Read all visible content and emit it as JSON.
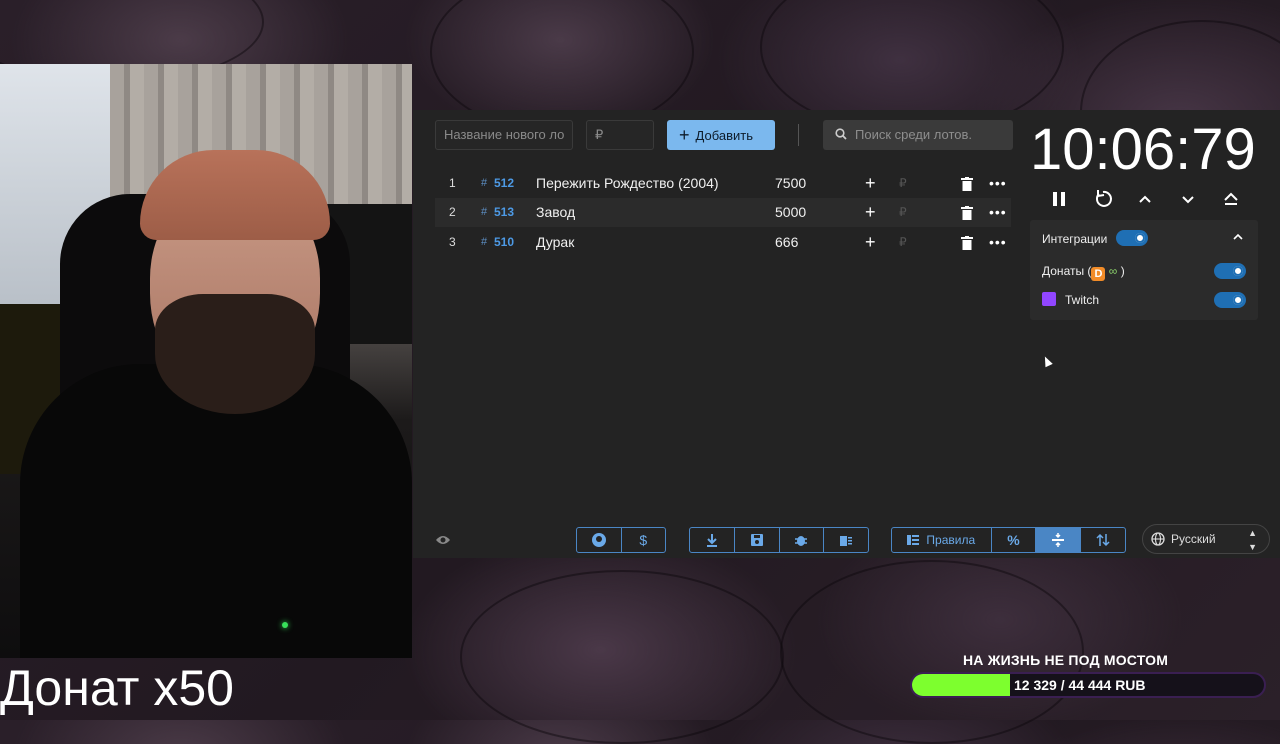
{
  "caption": "Донат x50",
  "lot_form": {
    "name_placeholder": "Название нового ло",
    "amount_placeholder": "₽",
    "add_label": "Добавить",
    "search_placeholder": "Поиск среди лотов."
  },
  "lots": [
    {
      "index": "1",
      "hash": "#",
      "id": "512",
      "name": "Пережить Рождество (2004)",
      "amount": "7500",
      "currency": "₽"
    },
    {
      "index": "2",
      "hash": "#",
      "id": "513",
      "name": "Завод",
      "amount": "5000",
      "currency": "₽"
    },
    {
      "index": "3",
      "hash": "#",
      "id": "510",
      "name": "Дурак",
      "amount": "666",
      "currency": "₽"
    }
  ],
  "timer": {
    "value": "10:06:79"
  },
  "integrations": {
    "title": "Интеграции",
    "donations_label": "Донаты (",
    "donations_close": ")",
    "twitch_label": "Twitch"
  },
  "toolbar": {
    "rules_label": "Правила",
    "percent_label": "%"
  },
  "language": {
    "selected": "Русский"
  },
  "goal": {
    "title": "НА ЖИЗНЬ НЕ ПОД МОСТОМ",
    "progress_text": "12 329 / 44 444 RUB",
    "current": 12329,
    "target": 44444
  },
  "colors": {
    "accent": "#7bb8ee",
    "toggle": "#1f6fb4",
    "goal_fill": "#7dff2e",
    "id_text": "#4d9ae6"
  }
}
